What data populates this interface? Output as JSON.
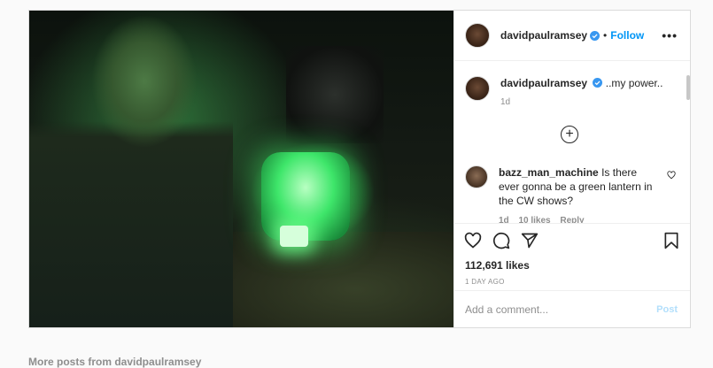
{
  "post": {
    "author": "davidpaulramsey",
    "follow_label": "Follow",
    "dot": "•",
    "more_label": "•••",
    "caption_text": "..my power..",
    "caption_age": "1d",
    "load_more": "+",
    "comment": {
      "user": "bazz_man_machine",
      "text": "Is there ever gonna be a green lantern in the CW shows?",
      "age": "1d",
      "likes": "10 likes",
      "reply": "Reply"
    },
    "likes_count": "112,691 likes",
    "timestamp": "1 DAY AGO",
    "add_comment_placeholder": "Add a comment...",
    "post_label": "Post"
  },
  "below_text": "More posts from davidpaulramsey",
  "colors": {
    "accent": "#0095f6",
    "verified": "#3897f0",
    "muted": "#8e8e8e"
  },
  "icons": [
    "verified-badge-icon",
    "more-options-icon",
    "load-more-icon",
    "heart-icon",
    "comment-icon",
    "share-icon",
    "bookmark-icon"
  ]
}
